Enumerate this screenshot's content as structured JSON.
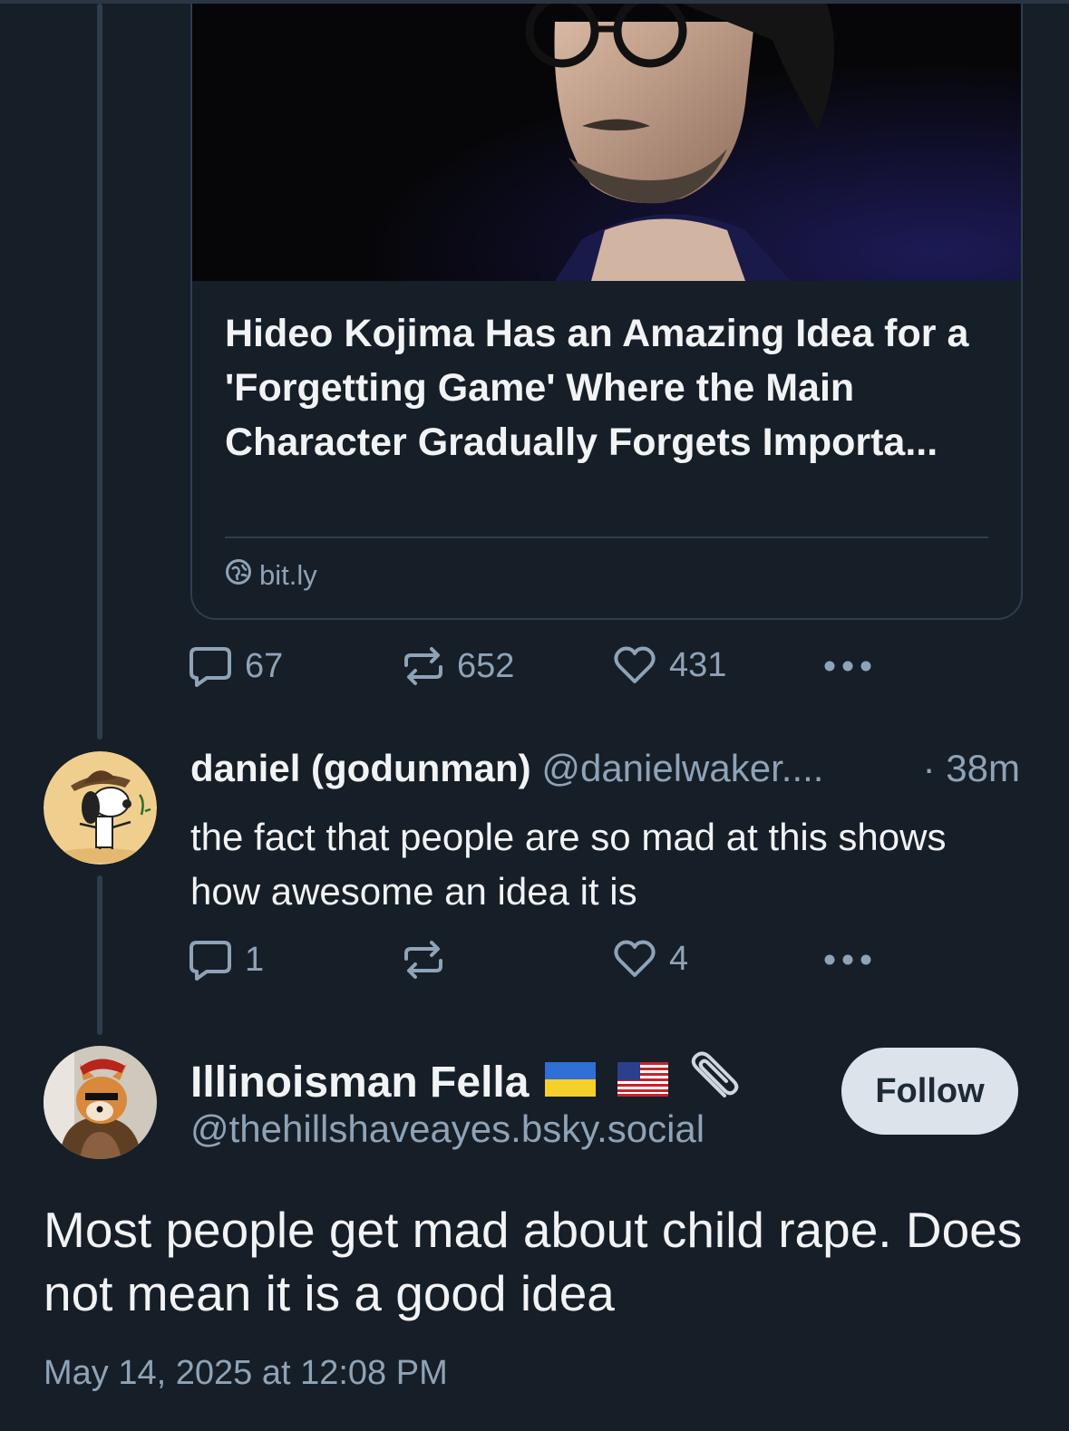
{
  "link_card": {
    "title": "Hideo Kojima Has an Amazing Idea for a 'Forgetting Game' Where the Main Character Gradually Forgets Importa...",
    "domain": "bit.ly",
    "image_alt": "Photo of Hideo Kojima"
  },
  "parent_post": {
    "reply_count": "67",
    "repost_count": "652",
    "like_count": "431"
  },
  "reply": {
    "display_name": "daniel (godunman)",
    "handle": "@danielwaker....",
    "time": "· 38m",
    "text": "the fact that people are so mad at this shows how awesome an idea it is",
    "reply_count": "1",
    "repost_count": "",
    "like_count": "4"
  },
  "main_post": {
    "display_name": "Illinoisman Fella",
    "name_icons": [
      "ukraine-flag-icon",
      "us-flag-icon",
      "paperclip-icon"
    ],
    "handle": "@thehillshaveayes.bsky.social",
    "follow_label": "Follow",
    "text": "Most people get mad about child rape. Does not mean it is a good idea",
    "date": "May 14, 2025 at 12:08 PM"
  },
  "colors": {
    "background": "#161e27",
    "muted_text": "#8fa3b7",
    "thread_line": "#2e3d4e",
    "follow_button_bg": "#dde3ea"
  }
}
